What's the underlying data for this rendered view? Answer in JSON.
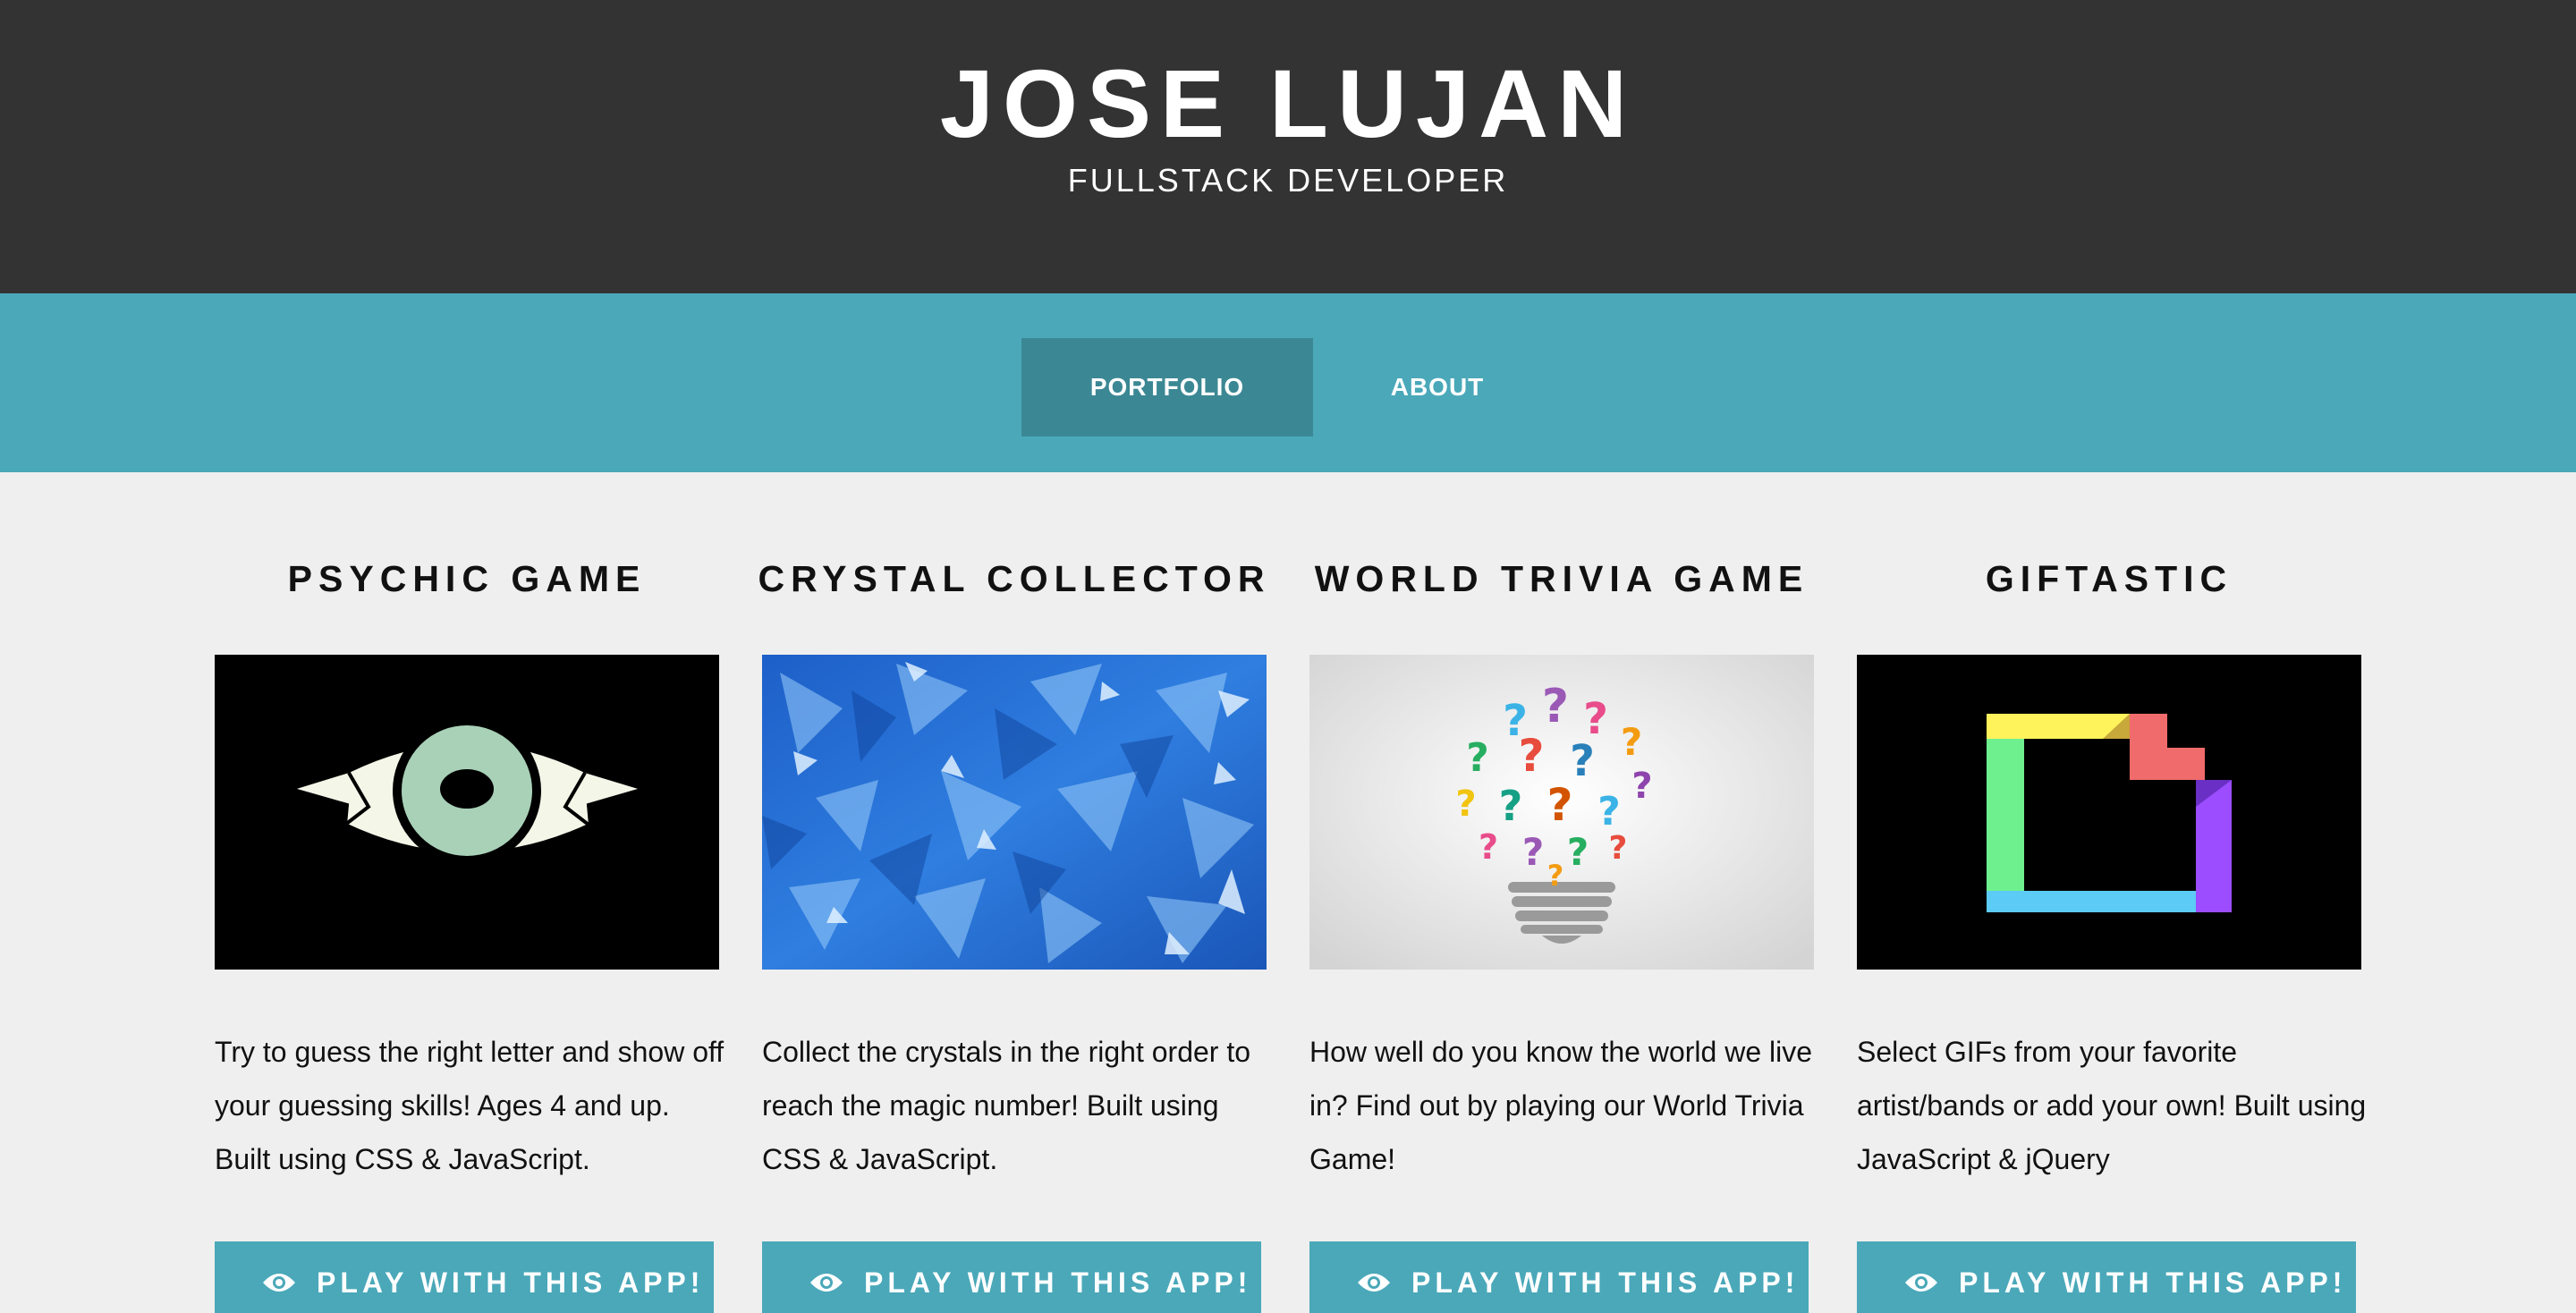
{
  "header": {
    "title": "JOSE LUJAN",
    "subtitle": "FULLSTACK DEVELOPER"
  },
  "nav": {
    "items": [
      {
        "label": "PORTFOLIO",
        "active": true
      },
      {
        "label": "ABOUT",
        "active": false
      }
    ]
  },
  "projects": [
    {
      "title": "PSYCHIC GAME",
      "image": "eye-image",
      "description": "Try to guess the right letter and show off your guessing skills! Ages 4 and up. Built using CSS & JavaScript.",
      "button": "PLAY WITH THIS APP!"
    },
    {
      "title": "CRYSTAL COLLECTOR",
      "image": "blue-crystals-image",
      "description": "Collect the crystals in the right order to reach the magic number! Built using CSS & JavaScript.",
      "button": "PLAY WITH THIS APP!"
    },
    {
      "title": "WORLD TRIVIA GAME",
      "image": "question-lightbulb-image",
      "description": "How well do you know the world we live in? Find out by playing our World Trivia Game!",
      "button": "PLAY WITH THIS APP!"
    },
    {
      "title": "GIFTASTIC",
      "image": "giphy-logo-image",
      "description": "Select GIFs from your favorite artist/bands or add your own! Built using JavaScript & jQuery",
      "button": "PLAY WITH THIS APP!"
    }
  ],
  "colors": {
    "header_bg": "#333333",
    "nav_bg": "#4aa8b9",
    "nav_active_bg": "#3b8894",
    "button_bg": "#4aa8b9",
    "page_bg": "#efefef"
  }
}
